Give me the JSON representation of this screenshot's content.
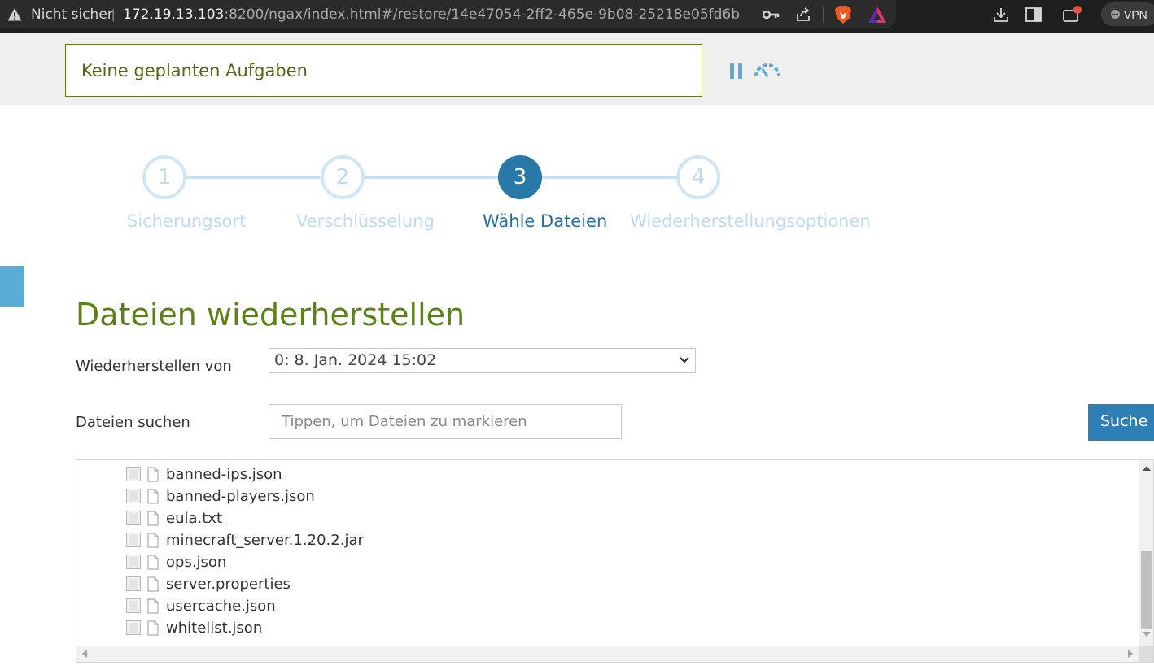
{
  "browser": {
    "warning_label": "Nicht sicher",
    "separator": "|",
    "url_host": "172.19.13.103",
    "url_rest": ":8200/ngax/index.html#/restore/14e47054-2ff2-465e-9b08-25218e05fd6b",
    "vpn_label": "VPN",
    "icons": [
      "key-icon",
      "share-icon",
      "brave-shield-icon",
      "brave-rewards-icon",
      "download-icon",
      "sidebar-icon",
      "wallet-icon"
    ]
  },
  "task": {
    "status_text": "Keine geplanten Aufgaben",
    "icons": [
      "pause-icon",
      "speed-icon"
    ]
  },
  "stepper": {
    "steps": [
      {
        "number": "1",
        "label": "Sicherungsort",
        "active": false
      },
      {
        "number": "2",
        "label": "Verschlüsselung",
        "active": false
      },
      {
        "number": "3",
        "label": "Wähle Dateien",
        "active": true
      },
      {
        "number": "4",
        "label": "Wiederherstellungsoptionen",
        "active": false
      }
    ]
  },
  "main": {
    "title": "Dateien wiederherstellen",
    "restore_from_label": "Wiederherstellen von",
    "restore_from_value": "0: 8. Jan. 2024 15:02",
    "search_label": "Dateien suchen",
    "search_placeholder": "Tippen, um Dateien zu markieren",
    "search_button": "Suche"
  },
  "files": [
    "banned-ips.json",
    "banned-players.json",
    "eula.txt",
    "minecraft_server.1.20.2.jar",
    "ops.json",
    "server.properties",
    "usercache.json",
    "whitelist.json"
  ],
  "colors": {
    "accent_blue": "#2979a8",
    "title_green": "#5a8214",
    "step_inactive": "#bfdced",
    "button_blue": "#2d7fb6"
  }
}
